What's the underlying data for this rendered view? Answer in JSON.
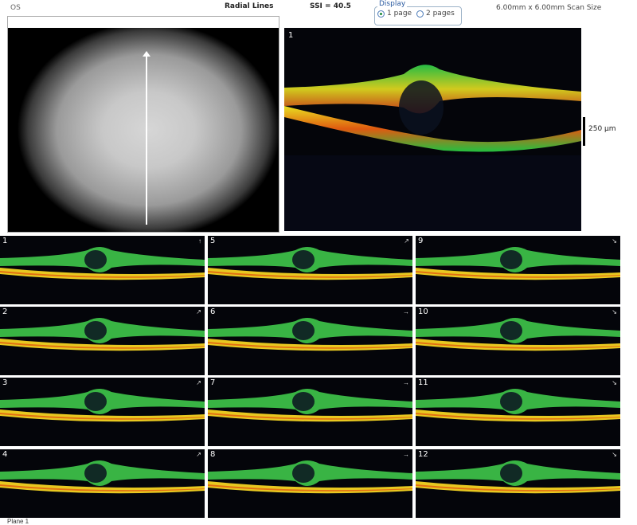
{
  "header": {
    "eye": "OS",
    "title": "Radial Lines",
    "ssi": "SSI = 40.5",
    "scan_size": "6.00mm x 6.00mm Scan Size"
  },
  "display": {
    "legend": "Display",
    "option1": "1 page",
    "option2": "2 pages",
    "selected": "1 page"
  },
  "main_scan": {
    "number": "1",
    "scale": "250 µm"
  },
  "tiles": [
    {
      "num": "1",
      "arrow": "↑"
    },
    {
      "num": "5",
      "arrow": "↗"
    },
    {
      "num": "9",
      "arrow": "↘"
    },
    {
      "num": "2",
      "arrow": "↗"
    },
    {
      "num": "6",
      "arrow": "→"
    },
    {
      "num": "10",
      "arrow": "↘"
    },
    {
      "num": "3",
      "arrow": "↗"
    },
    {
      "num": "7",
      "arrow": "→"
    },
    {
      "num": "11",
      "arrow": "↘"
    },
    {
      "num": "4",
      "arrow": "↗"
    },
    {
      "num": "8",
      "arrow": "→"
    },
    {
      "num": "12",
      "arrow": "↘"
    }
  ],
  "footer": "Plane 1"
}
